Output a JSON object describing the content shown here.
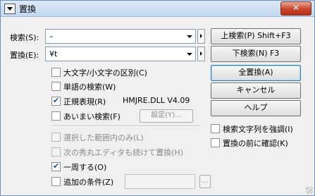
{
  "window": {
    "title": "置換",
    "close_label": "✕"
  },
  "search": {
    "label": "検索(S):",
    "value": "–"
  },
  "replace": {
    "label": "置換(E):",
    "value": "¥t"
  },
  "options": {
    "case": {
      "label": "大文字/小文字の区別(C)",
      "checked": false
    },
    "word": {
      "label": "単語の検索(W)",
      "checked": false
    },
    "regex": {
      "label": "正規表現(R)",
      "checked": true
    },
    "regex_engine": "HMJRE.DLL V4.09",
    "fuzzy": {
      "label": "あいまい検索(F)",
      "checked": false
    },
    "fuzzy_settings": "設定(Y)...",
    "selection_only": {
      "label": "選択した範囲内のみ(L)",
      "checked": false
    },
    "continue_next": {
      "label": "次の秀丸エディタも続けて置換(H)",
      "checked": false
    },
    "wrap": {
      "label": "一周する(O)",
      "checked": true
    },
    "extra": {
      "label": "追加の条件(Z)",
      "checked": false
    },
    "extra_button": "...",
    "highlight": {
      "label": "検索文字列を強調(I)",
      "checked": false
    },
    "confirm": {
      "label": "置換の前に確認(K)",
      "checked": false
    }
  },
  "buttons": {
    "search_up": "上検索(P) Shift+F3",
    "search_down": "下検索(N) F3",
    "replace_all": "全置換(A)",
    "cancel": "キャンセル",
    "help": "ヘルプ"
  }
}
